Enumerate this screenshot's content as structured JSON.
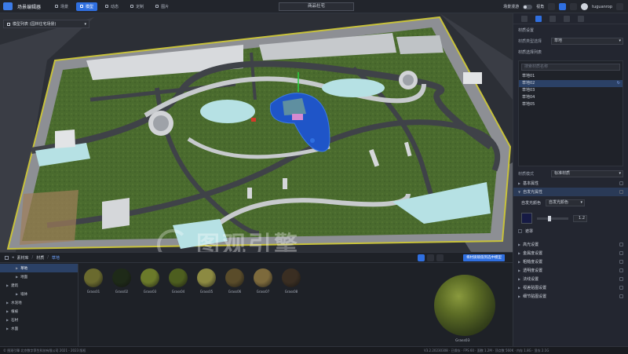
{
  "app": {
    "title": "场景编辑器"
  },
  "top_nav": [
    {
      "label": "场景",
      "active": false
    },
    {
      "label": "模型",
      "active": true
    },
    {
      "label": "动态",
      "active": false
    },
    {
      "label": "定制",
      "active": false
    },
    {
      "label": "图片",
      "active": false
    }
  ],
  "scene_title": "商品社宅",
  "top_right": {
    "toggle_label": "场景漫游",
    "view_label": "视角",
    "user": "tuguanrop"
  },
  "viewport": {
    "layer_select": "模型列表 (园林住宅场景)",
    "watermark": "图观引擎"
  },
  "right_panel": {
    "section": "材质设置",
    "type_label": "材质类型选择",
    "type_value": "草地",
    "list_title": "材质选择列表",
    "search_placeholder": "搜索材质名称",
    "materials": [
      {
        "name": "草地01",
        "selected": false
      },
      {
        "name": "草地02",
        "selected": true
      },
      {
        "name": "草地03",
        "selected": false
      },
      {
        "name": "草地04",
        "selected": false
      },
      {
        "name": "草地05",
        "selected": false
      }
    ],
    "mode_label": "材质模式",
    "mode_value": "标准材质",
    "groups_top": [
      {
        "label": "基本属性",
        "open": false
      },
      {
        "label": "自发光属性",
        "open": true
      }
    ],
    "color_label": "自发光颜色",
    "color_value": "自发光颜色",
    "color_hex": "#161a44",
    "intensity": "1.2",
    "mask_label": "遮罩",
    "groups_bottom": [
      {
        "label": "高光设置"
      },
      {
        "label": "金属度设置"
      },
      {
        "label": "粗糙度设置"
      },
      {
        "label": "透明度设置"
      },
      {
        "label": "法线设置"
      },
      {
        "label": "视差贴图设置"
      },
      {
        "label": "细节贴图设置"
      }
    ]
  },
  "bottom_panel": {
    "breadcrumb": [
      "素材库",
      "材质",
      "草地"
    ],
    "apply_button": "将材质赋值到选中模型",
    "tree": [
      {
        "label": "草地",
        "child": true,
        "selected": true
      },
      {
        "label": "地面",
        "child": true,
        "selected": false
      },
      {
        "label": "建筑",
        "child": false,
        "selected": false
      },
      {
        "label": "墙体",
        "child": true,
        "selected": false
      },
      {
        "label": "水泥地",
        "child": false,
        "selected": false
      },
      {
        "label": "植被",
        "child": false,
        "selected": false
      },
      {
        "label": "石材",
        "child": false,
        "selected": false
      },
      {
        "label": "水面",
        "child": false,
        "selected": false
      }
    ],
    "thumbnails": [
      {
        "name": "Grass01",
        "color": "#6a6a2e"
      },
      {
        "name": "Grass02",
        "color": "#1e2a18"
      },
      {
        "name": "Grass03",
        "color": "#6b7a2a"
      },
      {
        "name": "Grass04",
        "color": "#4d5e1f"
      },
      {
        "name": "Grass05",
        "color": "#8c8a42"
      },
      {
        "name": "Grass06",
        "color": "#5a4c2a"
      },
      {
        "name": "Grass07",
        "color": "#7d6a3c"
      },
      {
        "name": "Grass08",
        "color": "#3a2e22"
      }
    ],
    "preview_name": "Grass03"
  },
  "status": {
    "left": "© 图观引擎 北京数字孪生科技有限公司 2021 - 2023 版权",
    "right": "V3.2.20230308 · 已保存 · FPS 60 · 面数 1.2M · 顶点数 560K · 内存 1.8G · 显存 2.1G"
  }
}
